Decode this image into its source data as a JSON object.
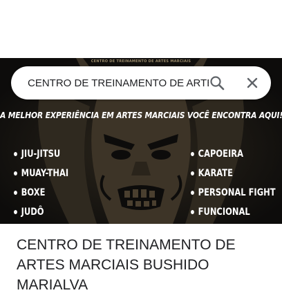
{
  "search": {
    "value": "CENTRO DE TREINAMENTO DE ARTES MARCIAIS BUSHIDO MARIALVA",
    "search_icon": "search-icon",
    "close_icon": "close-icon"
  },
  "banner": {
    "caption": "CENTRO DE TREINAMENTO DE ARTES MARCIAIS",
    "headline": "A MELHOR EXPERIÊNCIA EM ARTES MARCIAIS VOCÊ ENCONTRA AQUI!",
    "left_list": [
      "JIU-JITSU",
      "MUAY-THAI",
      "BOXE",
      "JUDÔ"
    ],
    "right_list": [
      "CAPOEIRA",
      "KARATE",
      "PERSONAL FIGHT",
      "FUNCIONAL"
    ]
  },
  "place": {
    "title": "CENTRO DE TREINAMENTO DE ARTES MARCIAIS BUSHIDO MARIALVA"
  },
  "colors": {
    "banner_bg": "#0d0c0b",
    "mask_gold": "#3a3226"
  }
}
